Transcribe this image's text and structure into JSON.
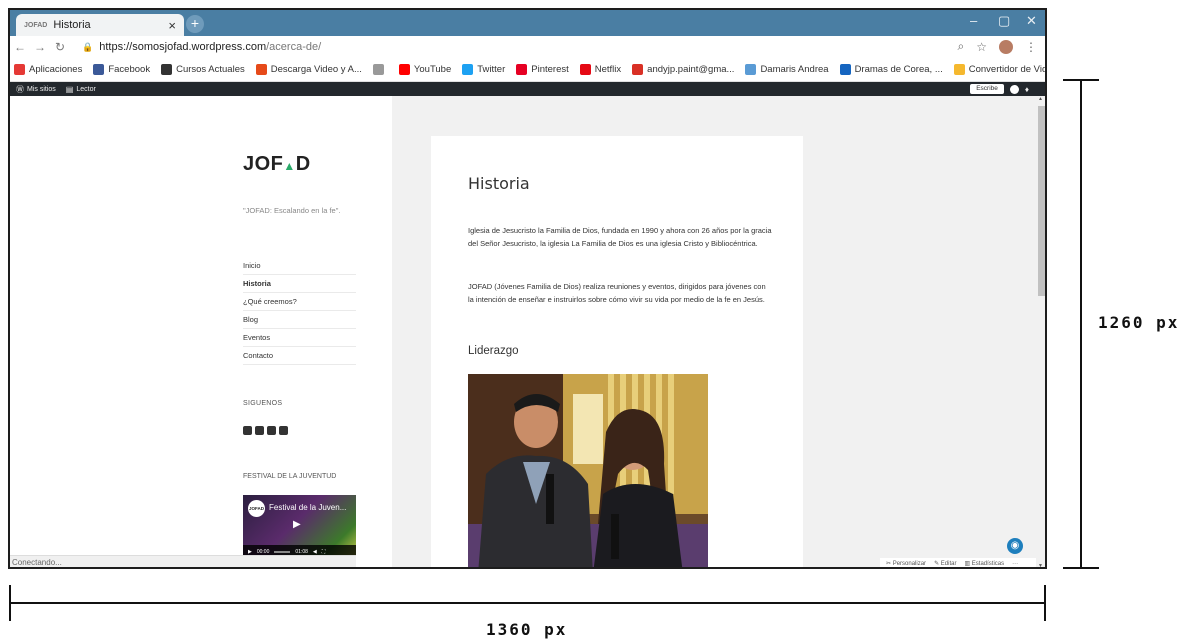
{
  "browser": {
    "tab_title": "Historia",
    "tab_favicon": "JOFAD",
    "url_host": "https://somosjofad.wordpress.com",
    "url_path": "/acerca-de/"
  },
  "bookmarks": [
    {
      "label": "Aplicaciones",
      "color": "#e53935",
      "icon": "apps-grid-icon"
    },
    {
      "label": "Facebook",
      "color": "#3b5998",
      "icon": "facebook-icon"
    },
    {
      "label": "Cursos Actuales",
      "color": "#333333",
      "icon": "course-icon"
    },
    {
      "label": "Descarga Video y A...",
      "color": "#e64a19",
      "icon": "download-icon"
    },
    {
      "label": "",
      "color": "#999999",
      "icon": "page-icon"
    },
    {
      "label": "YouTube",
      "color": "#ff0000",
      "icon": "youtube-icon"
    },
    {
      "label": "Twitter",
      "color": "#1da1f2",
      "icon": "twitter-icon"
    },
    {
      "label": "Pinterest",
      "color": "#e60023",
      "icon": "pinterest-icon"
    },
    {
      "label": "Netflix",
      "color": "#e50914",
      "icon": "netflix-icon"
    },
    {
      "label": "andyjp.paint@gma...",
      "color": "#d93025",
      "icon": "gmail-icon"
    },
    {
      "label": "Damaris Andrea",
      "color": "#5a9bd5",
      "icon": "profile-icon"
    },
    {
      "label": "Dramas de Corea, ...",
      "color": "#1565c0",
      "icon": "r-icon"
    },
    {
      "label": "Convertidor de Vid...",
      "color": "#f5b82e",
      "icon": "convert-icon"
    }
  ],
  "wpbar": {
    "my_sites": "Mis sitios",
    "reader": "Lector",
    "write": "Escribe"
  },
  "sidebar": {
    "logo_left": "JOF",
    "logo_right": "D",
    "tagline": "\"JOFAD: Escalando en la fe\".",
    "menu": [
      {
        "label": "Inicio",
        "active": false
      },
      {
        "label": "Historia",
        "active": true
      },
      {
        "label": "¿Qué creemos?",
        "active": false
      },
      {
        "label": "Blog",
        "active": false
      },
      {
        "label": "Eventos",
        "active": false
      },
      {
        "label": "Contacto",
        "active": false
      }
    ],
    "follow_title": "SIGUENOS",
    "festival_title": "FESTIVAL DE LA JUVENTUD",
    "video_title": "Festival de la Juven...",
    "video_badge": "JOFAD",
    "video_time_current": "00:00",
    "video_time_total": "01:08"
  },
  "status_text": "Conectando...",
  "post": {
    "title": "Historia",
    "p1": "Iglesia de Jesucristo la Familia de Dios, fundada en 1990 y ahora con 26 años por la gracia del Señor Jesucristo, la iglesia La Familia de Dios es una iglesia Cristo y Bibliocéntrica.",
    "p2": "JOFAD (Jóvenes Familia de Dios) realiza reuniones y eventos, dirigidos para jóvenes con la intención de enseñar e instruirlos sobre cómo vivir su vida por medio de la fe en Jesús.",
    "subtitle": "Liderazgo"
  },
  "admin_footer": {
    "customize": "Personalizar",
    "edit": "Editar",
    "stats": "Estadísticas",
    "more": "···"
  },
  "dimensions": {
    "height_label": "1260 px",
    "width_label": "1360 px"
  }
}
